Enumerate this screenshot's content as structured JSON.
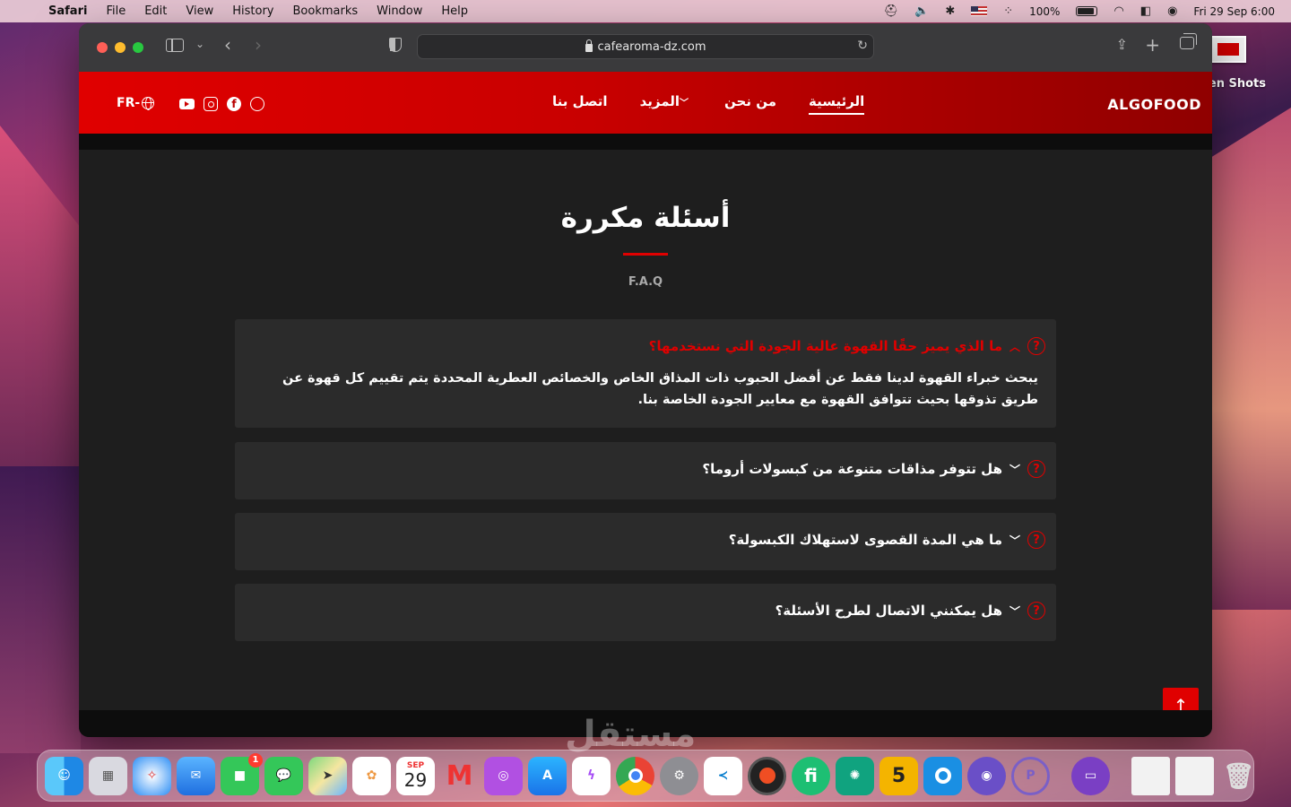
{
  "menubar": {
    "app_name": "Safari",
    "items": [
      "File",
      "Edit",
      "View",
      "History",
      "Bookmarks",
      "Window",
      "Help"
    ],
    "battery": "100%",
    "datetime": "Fri 29 Sep  6:00"
  },
  "desktop": {
    "folder_label": "en Shots"
  },
  "browser": {
    "url": "cafearoma-dz.com"
  },
  "site": {
    "brand": "ALGOFOOD",
    "nav": [
      {
        "label": "الرئيسية",
        "active": true
      },
      {
        "label": "من نحن"
      },
      {
        "label": "المزيد",
        "has_dropdown": true
      },
      {
        "label": "اتصل بنا"
      }
    ],
    "lang_switch": "FR-",
    "page_title": "أسئلة مكررة",
    "page_subtitle": "F.A.Q",
    "faqs": [
      {
        "question": "ما الذي يميز حقًا القهوة عالية الجودة التي نستخدمها؟",
        "answer": "يبحث خبراء القهوة لدينا فقط عن أفضل الحبوب ذات المذاق الخاص والخصائص العطرية المحددة يتم تقييم كل قهوة عن طريق تذوقها بحيث تتوافق القهوة مع معايير الجودة الخاصة بنا.",
        "open": true
      },
      {
        "question": "هل تتوفر مذاقات متنوعة من كبسولات أروما؟",
        "open": false
      },
      {
        "question": "ما هي المدة القصوى لاستهلاك الكبسولة؟",
        "open": false
      },
      {
        "question": "هل يمكنني الاتصال لطرح الأسئلة؟",
        "open": false
      }
    ]
  },
  "dock": {
    "calendar_month": "SEP",
    "calendar_day": "29",
    "facetime_badge": "1",
    "watermark": "مستقل"
  },
  "colors": {
    "accent": "#e00000",
    "header_dark": "#8f0000",
    "content_bg": "#1e1e1e",
    "card_bg": "#2b2b2b"
  }
}
